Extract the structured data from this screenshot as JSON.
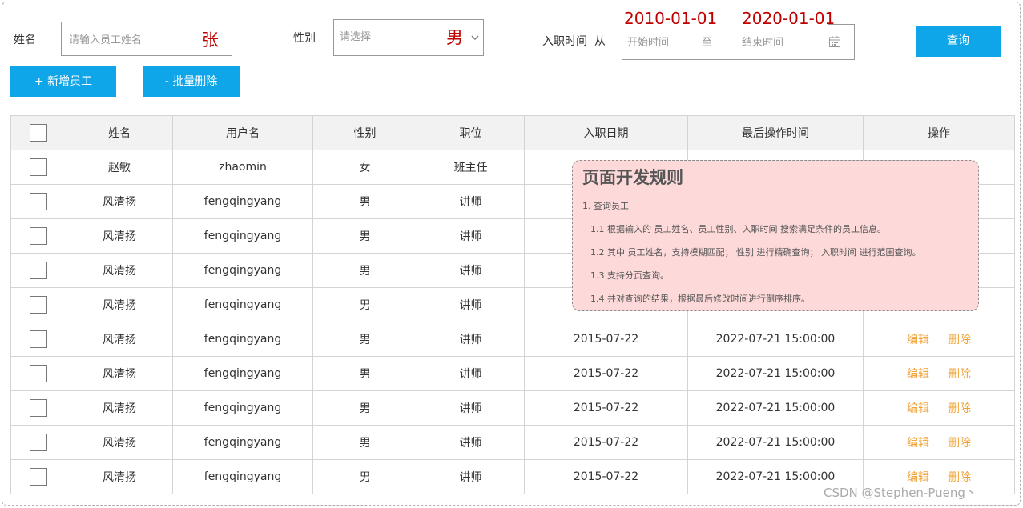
{
  "search": {
    "name_label": "姓名",
    "name_placeholder": "请输入员工姓名",
    "name_value": "张",
    "gender_label": "性别",
    "gender_placeholder": "请选择",
    "gender_value": "男",
    "date_label": "入职时间",
    "date_from": "从",
    "date_start_placeholder": "开始时间",
    "date_sep": "至",
    "date_end_placeholder": "结束时间",
    "date_start_value": "2010-01-01",
    "date_end_value": "2020-01-01",
    "query_button": "查询"
  },
  "actions": {
    "add_button": "+ 新增员工",
    "batch_delete_button": "- 批量删除"
  },
  "table": {
    "headers": [
      "姓名",
      "用户名",
      "性别",
      "职位",
      "入职日期",
      "最后操作时间",
      "操作"
    ],
    "edit_label": "编辑",
    "delete_label": "删除",
    "rows": [
      {
        "name": "赵敏",
        "username": "zhaomin",
        "gender": "女",
        "position": "班主任",
        "hire_date": "",
        "updated": ""
      },
      {
        "name": "风清扬",
        "username": "fengqingyang",
        "gender": "男",
        "position": "讲师",
        "hire_date": "",
        "updated": ""
      },
      {
        "name": "风清扬",
        "username": "fengqingyang",
        "gender": "男",
        "position": "讲师",
        "hire_date": "",
        "updated": ""
      },
      {
        "name": "风清扬",
        "username": "fengqingyang",
        "gender": "男",
        "position": "讲师",
        "hire_date": "",
        "updated": ""
      },
      {
        "name": "风清扬",
        "username": "fengqingyang",
        "gender": "男",
        "position": "讲师",
        "hire_date": "",
        "updated": ""
      },
      {
        "name": "风清扬",
        "username": "fengqingyang",
        "gender": "男",
        "position": "讲师",
        "hire_date": "2015-07-22",
        "updated": "2022-07-21 15:00:00"
      },
      {
        "name": "风清扬",
        "username": "fengqingyang",
        "gender": "男",
        "position": "讲师",
        "hire_date": "2015-07-22",
        "updated": "2022-07-21 15:00:00"
      },
      {
        "name": "风清扬",
        "username": "fengqingyang",
        "gender": "男",
        "position": "讲师",
        "hire_date": "2015-07-22",
        "updated": "2022-07-21 15:00:00"
      },
      {
        "name": "风清扬",
        "username": "fengqingyang",
        "gender": "男",
        "position": "讲师",
        "hire_date": "2015-07-22",
        "updated": "2022-07-21 15:00:00"
      },
      {
        "name": "风清扬",
        "username": "fengqingyang",
        "gender": "男",
        "position": "讲师",
        "hire_date": "2015-07-22",
        "updated": "2022-07-21 15:00:00"
      }
    ]
  },
  "note": {
    "title": "页面开发规则",
    "lines": [
      "1. 查询员工",
      "1.1 根据输入的 员工姓名、员工性别、入职时间 搜索满足条件的员工信息。",
      "1.2 其中 员工姓名，支持模糊匹配； 性别 进行精确查询； 入职时间 进行范围查询。",
      "1.3 支持分页查询。",
      "1.4 并对查询的结果，根据最后修改时间进行倒序排序。"
    ]
  },
  "watermark": "CSDN @Stephen-Pueng丶",
  "colors": {
    "primary": "#0ea5e9",
    "annotation_red": "#c00000",
    "action_orange": "#f0a030",
    "note_bg": "#fdd9d9"
  },
  "icons": [
    "chevron-down-icon",
    "calendar-icon"
  ]
}
